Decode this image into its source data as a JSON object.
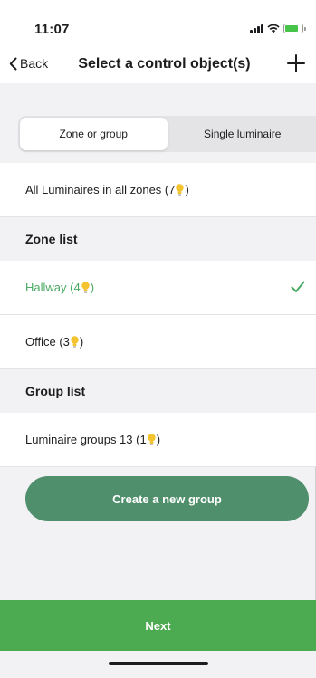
{
  "status": {
    "time": "11:07",
    "battery_level": 0.8,
    "battery_color": "#47c44a"
  },
  "nav": {
    "back_label": "Back",
    "title": "Select a control object(s)",
    "add_icon": "plus-icon"
  },
  "segment": {
    "options": [
      "Zone or group",
      "Single luminaire"
    ],
    "selected": "Zone or group"
  },
  "all_luminaires": {
    "label": "All Luminaires in all zones (7",
    "suffix": ")"
  },
  "zone_list": {
    "header": "Zone list",
    "items": [
      {
        "label": "Hallway (4",
        "suffix": ")",
        "selected": true
      },
      {
        "label": "Office (3",
        "suffix": ")",
        "selected": false
      }
    ]
  },
  "group_list": {
    "header": "Group list",
    "items": [
      {
        "label": "Luminaire groups 13 (1",
        "suffix": ")"
      }
    ]
  },
  "create_group_label": "Create a new group",
  "next_label": "Next",
  "colors": {
    "accent_green": "#4caa50",
    "create_button": "#4f8f6b",
    "selected_text": "#4caa64",
    "bulb_yellow": "#f4c430"
  }
}
